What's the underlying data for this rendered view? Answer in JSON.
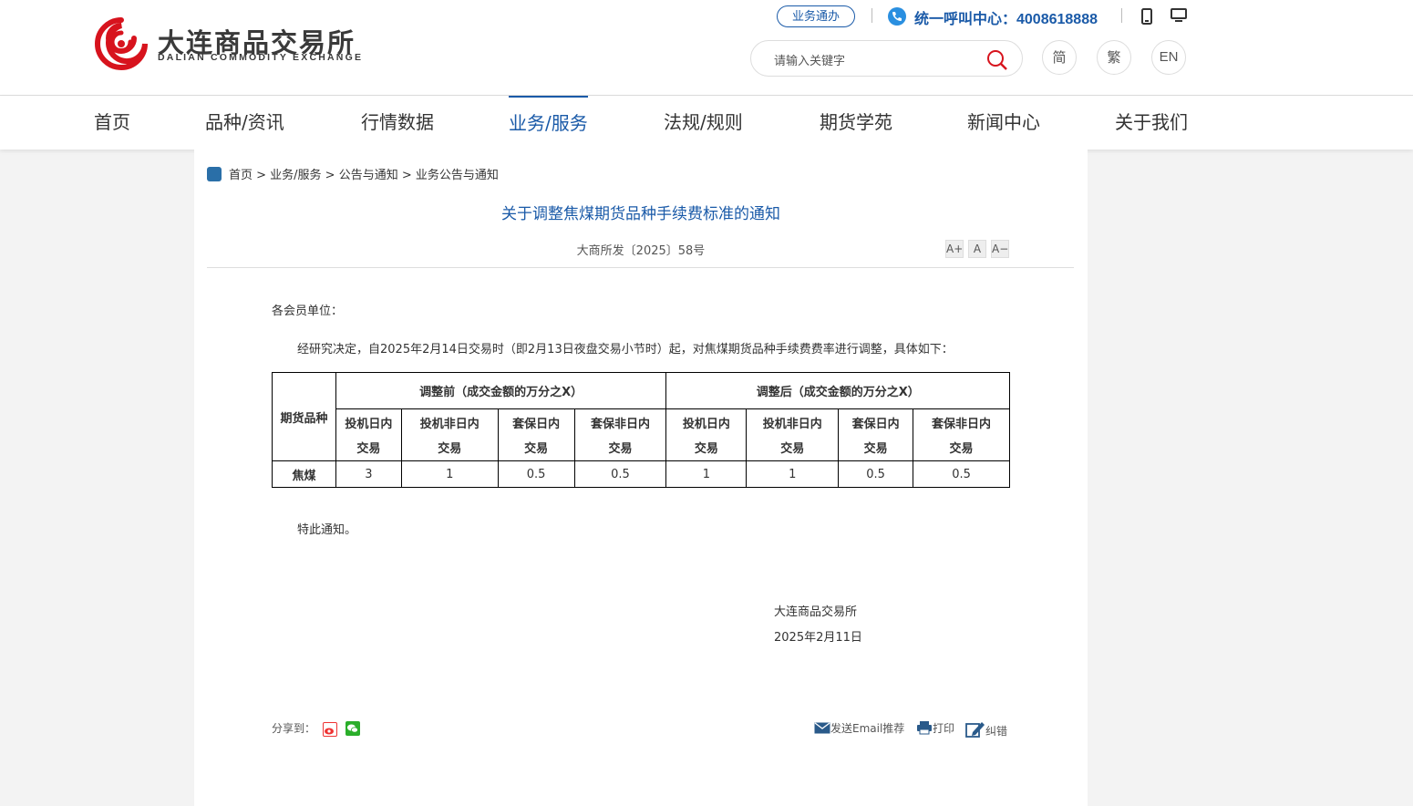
{
  "header": {
    "logo_cn": "大连商品交易所",
    "logo_en": "DALIAN COMMODITY EXCHANGE",
    "biz_button": "业务通办",
    "hotline": "统一呼叫中心：4008618888",
    "search_placeholder": "请输入关键字",
    "lang": [
      "简",
      "繁",
      "EN"
    ]
  },
  "nav": {
    "items": [
      "首页",
      "品种/资讯",
      "行情数据",
      "业务/服务",
      "法规/规则",
      "期货学苑",
      "新闻中心",
      "关于我们"
    ],
    "active": "业务/服务"
  },
  "breadcrumb": "首页 > 业务/服务 > 公告与通知 > 业务公告与通知",
  "article": {
    "title": "关于调整焦煤期货品种手续费标准的通知",
    "doc_no": "大商所发〔2025〕58号",
    "font_controls": [
      "A+",
      "A",
      "A−"
    ],
    "greeting": "各会员单位：",
    "body": "经研究决定，自2025年2月14日交易时（即2月13日夜盘交易小节时）起，对焦煤期货品种手续费费率进行调整，具体如下：",
    "closing": "特此通知。",
    "signature": "大连商品交易所",
    "date": "2025年2月11日"
  },
  "table": {
    "col0": "期货品种",
    "group_before": "调整前（成交金额的万分之X）",
    "group_after": "调整后（成交金额的万分之X）",
    "sub": [
      [
        "投机日内",
        "交易"
      ],
      [
        "投机非日内",
        "交易"
      ],
      [
        "套保日内",
        "交易"
      ],
      [
        "套保非日内",
        "交易"
      ],
      [
        "投机日内",
        "交易"
      ],
      [
        "投机非日内",
        "交易"
      ],
      [
        "套保日内",
        "交易"
      ],
      [
        "套保非日内",
        "交易"
      ]
    ],
    "row_label": "焦煤",
    "row_values": [
      "3",
      "1",
      "0.5",
      "0.5",
      "1",
      "1",
      "0.5",
      "0.5"
    ]
  },
  "footer_tools": {
    "share_label": "分享到：",
    "email": "发送Email推荐",
    "print": "打印",
    "correct": "纠错"
  }
}
